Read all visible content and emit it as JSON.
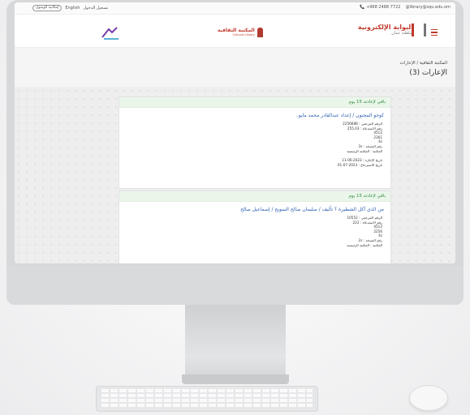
{
  "topbar": {
    "phone": "📞 +968 2488 7722",
    "email": "@library@squ.edu.om",
    "login": "تسجيل الدخول",
    "lang": "English",
    "access": "إمكانية الوصول"
  },
  "header": {
    "portal_title": "البوابة الإلكترونية",
    "portal_sub": "سلطنة عمان",
    "library_title": "المكتبة الثقافية",
    "library_sub": "Cultural Library"
  },
  "breadcrumb": "المكتبة الثقافية / الإعارات",
  "page_title": "الإعارات (3)",
  "loans": [
    {
      "status": "باقي لإعادته 15 يوم",
      "book": "كوجو المجنون / إعداد عبدالقادر محمد مايو..",
      "lines": [
        "الرقم المرجعي : 2256688",
        "رقم الاستدعاء : 255.03",
        "4512",
        "2361",
        "4s",
        "رقم النسخة : 3s",
        "المكتبة : المكتبة الرئيسية"
      ],
      "dates": [
        "تاريخ الإعارة : 2023-06-11",
        "تاريخ الاسترجاع : 2023-07-01"
      ]
    },
    {
      "status": "باقي لإعادته 15 يوم",
      "book": "من الذي أكل الشطيرة ؟ تأليف / سليمان صالح السويح / إسماعيل صالح",
      "lines": [
        "الرقم المرجعي : 10552",
        "رقم الاستدعاء : 222",
        "4512",
        "2256",
        "4s",
        "رقم النسخة : 2s",
        "المكتبة : المكتبة الرئيسية"
      ],
      "dates": []
    }
  ],
  "colors": {
    "brand_red": "#c0392b",
    "status_green": "#2e8b3d",
    "link_blue": "#2a5db0"
  }
}
